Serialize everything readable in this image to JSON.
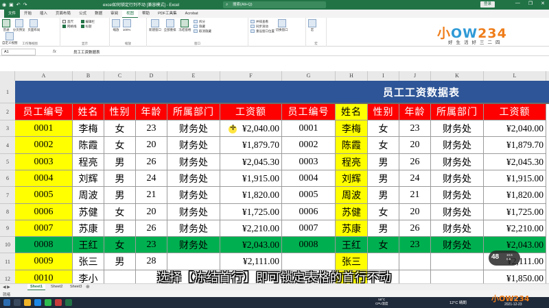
{
  "titlebar": {
    "doc_title": "excel如何锁定行列不动 [兼容模式] - Excel",
    "search_placeholder": "搜索(Alt+Q)",
    "login": "登录",
    "min": "—",
    "restore": "❐",
    "close": "✕"
  },
  "tabs": [
    "文件",
    "开始",
    "插入",
    "页面布局",
    "公式",
    "数据",
    "审阅",
    "视图",
    "帮助",
    "PDF工具集",
    "Acrobat"
  ],
  "active_tab": "视图",
  "ribbon": {
    "groups": {
      "workbook_views": {
        "name": "工作簿视图",
        "normal": "普通",
        "page_break": "分页预览",
        "page_layout": "页面布局",
        "custom": "自定义视图"
      },
      "show": {
        "name": "显示",
        "ruler": "直尺",
        "formula_bar": "编辑栏",
        "gridlines": "网格线",
        "headings": "标题"
      },
      "zoom": {
        "name": "缩放",
        "zoom": "缩放",
        "hundred": "100%",
        "selection": "缩放到选定区域"
      },
      "window": {
        "name": "窗口",
        "new_window": "新建窗口",
        "arrange_all": "全部重排",
        "freeze": "冻结窗格",
        "split": "拆分",
        "hide": "隐藏",
        "unhide": "取消隐藏",
        "side_by_side": "并排查看",
        "sync_scroll": "同步滚动",
        "reset": "重设窗口位置",
        "switch": "切换窗口"
      },
      "macros": {
        "name": "宏",
        "macros": "宏"
      }
    }
  },
  "logo": {
    "brand_a": "小",
    "brand_b": "OW",
    "brand_digits": "234",
    "slogan": "好生活好三二四"
  },
  "formula_bar": {
    "name_box": "A1",
    "fx": "fx",
    "content": "员工工资数据表"
  },
  "columns": [
    "A",
    "B",
    "C",
    "D",
    "E",
    "F",
    "G",
    "H",
    "I",
    "J",
    "K",
    "L"
  ],
  "row_numbers": [
    "1",
    "2",
    "3",
    "4",
    "5",
    "6",
    "7",
    "8",
    "9",
    "10",
    "11",
    "12"
  ],
  "sheet_title": "员工工资数据表",
  "headers": [
    "员工编号",
    "姓名",
    "性别",
    "年龄",
    "所属部门",
    "工资额",
    "员工编号",
    "姓名",
    "性别",
    "年龄",
    "所属部门",
    "工资额"
  ],
  "rows": [
    [
      "0001",
      "李梅",
      "女",
      "23",
      "财务处",
      "¥2,040.00",
      "0001",
      "李梅",
      "女",
      "23",
      "财务处",
      "¥2,040.00"
    ],
    [
      "0002",
      "陈霞",
      "女",
      "20",
      "财务处",
      "¥1,879.70",
      "0002",
      "陈霞",
      "女",
      "20",
      "财务处",
      "¥1,879.70"
    ],
    [
      "0003",
      "程亮",
      "男",
      "26",
      "财务处",
      "¥2,045.30",
      "0003",
      "程亮",
      "男",
      "26",
      "财务处",
      "¥2,045.30"
    ],
    [
      "0004",
      "刘辉",
      "男",
      "24",
      "财务处",
      "¥1,915.00",
      "0004",
      "刘辉",
      "男",
      "24",
      "财务处",
      "¥1,915.00"
    ],
    [
      "0005",
      "周波",
      "男",
      "21",
      "财务处",
      "¥1,820.00",
      "0005",
      "周波",
      "男",
      "21",
      "财务处",
      "¥1,820.00"
    ],
    [
      "0006",
      "苏健",
      "女",
      "20",
      "财务处",
      "¥1,725.00",
      "0006",
      "苏健",
      "女",
      "20",
      "财务处",
      "¥1,725.00"
    ],
    [
      "0007",
      "苏康",
      "男",
      "26",
      "财务处",
      "¥2,210.00",
      "0007",
      "苏康",
      "男",
      "26",
      "财务处",
      "¥2,210.00"
    ],
    [
      "0008",
      "王红",
      "女",
      "23",
      "财务处",
      "¥2,043.00",
      "0008",
      "王红",
      "女",
      "23",
      "财务处",
      "¥2,043.00"
    ],
    [
      "0009",
      "张三",
      "男",
      "28",
      "",
      "¥2,111.00",
      "",
      "张三",
      "",
      "",
      "",
      "¥2,111.00"
    ],
    [
      "0010",
      "李小",
      "",
      "",
      "",
      "",
      "",
      "",
      "",
      "",
      "",
      "¥1,850.00"
    ]
  ],
  "sheet_tabs": [
    "Sheet1",
    "Sheet2",
    "Sheet3"
  ],
  "active_sheet": "Sheet1",
  "status": {
    "ready": "就绪"
  },
  "taskbar": {
    "cpu_temp": "58°C",
    "cpu_label": "CPU温度",
    "weather": "12°C 晴朗",
    "time": "11:11",
    "date": "2021-12-23"
  },
  "subtitle": "选择【冻结首行】即可锁定表格的首行不动",
  "perf_widget": {
    "value": "48",
    "line1": "10.6",
    "line2": "0.6"
  },
  "watermark": "小OW234",
  "colors": {
    "excel_green": "#217346",
    "title_row": "#2e5597",
    "header_red": "#ff0000",
    "id_yellow": "#ffff00",
    "row8_green": "#00b050",
    "logo_orange": "#ef7d1a",
    "logo_blue": "#2f9ad6"
  },
  "icons": {
    "undo": "undo-icon",
    "redo": "redo-icon",
    "save": "save-icon",
    "search": "search-icon",
    "cursor": "cursor-crosshair-icon"
  }
}
